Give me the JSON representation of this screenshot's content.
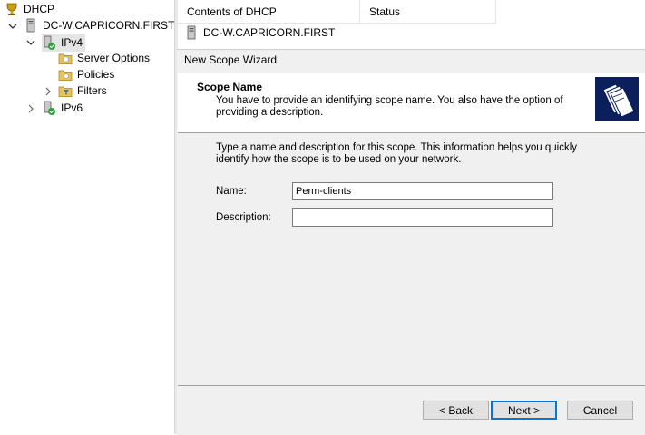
{
  "tree": {
    "root": "DHCP",
    "server": "DC-W.CAPRICORN.FIRST",
    "ipv4": "IPv4",
    "server_options": "Server Options",
    "policies": "Policies",
    "filters": "Filters",
    "ipv6": "IPv6"
  },
  "list": {
    "col_contents": "Contents of DHCP",
    "col_status": "Status",
    "row_server": "DC-W.CAPRICORN.FIRST"
  },
  "wizard": {
    "window_title": "New Scope Wizard",
    "header_title": "Scope Name",
    "header_desc": "You have to provide an identifying scope name. You also have the option of providing a description.",
    "instructions": "Type a name and description for this scope. This information helps you quickly identify how the scope is to be used on your network.",
    "name_label": "Name:",
    "name_value": "Perm-clients",
    "description_label": "Description:",
    "description_value": "",
    "back_label": "< Back",
    "next_label": "Next >",
    "cancel_label": "Cancel"
  },
  "colors": {
    "header_icon_bg": "#0b1f5c",
    "default_button_border": "#0078d7",
    "dialog_bg": "#f0f0f0"
  }
}
